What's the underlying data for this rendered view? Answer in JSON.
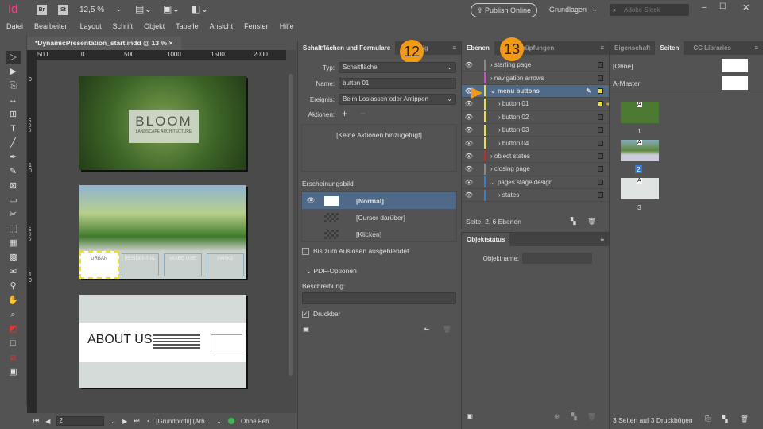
{
  "app": {
    "logo": "Id",
    "bridge": "Br",
    "stock": "St",
    "zoom": "12,5 %",
    "publish": "Publish Online",
    "workspace": "Grundlagen",
    "search_placeholder": "Adobe Stock"
  },
  "menu": [
    "Datei",
    "Bearbeiten",
    "Layout",
    "Schrift",
    "Objekt",
    "Tabelle",
    "Ansicht",
    "Fenster",
    "Hilfe"
  ],
  "document": {
    "tab": "*DynamicPresentation_start.indd @ 13 %",
    "ruler": [
      "500",
      "0",
      "500",
      "1000",
      "1500",
      "2000"
    ],
    "vruler": [
      "0",
      "5 0 0",
      "1 0",
      "5 0 0",
      "1 0"
    ],
    "page1": {
      "title": "BLOOM",
      "subtitle": "LANDSCAPE ARCHITECTURE"
    },
    "page2": {
      "buttons": [
        "URBAN",
        "RESIDENTIAL",
        "MIXED USE",
        "PARKS"
      ]
    },
    "page3": {
      "title": "ABOUT US"
    }
  },
  "status": {
    "page": "2",
    "profile": "[Grundprofil] (Arb...",
    "preflight": "Ohne Feh",
    "ok_color": "#3fb950"
  },
  "buttons_panel": {
    "title": "Schaltflächen und Formulare",
    "tab2": "zeig",
    "badge": "12",
    "type_label": "Typ:",
    "type_value": "Schaltfläche",
    "name_label": "Name:",
    "name_value": "button 01",
    "event_label": "Ereignis:",
    "event_value": "Beim Loslassen oder Antippen",
    "actions_label": "Aktionen:",
    "no_actions": "[Keine Aktionen hinzugefügt]",
    "appearance_label": "Erscheinungsbild",
    "states": [
      "[Normal]",
      "[Cursor darüber]",
      "[Klicken]"
    ],
    "hidden_label": "Bis zum Auslösen ausgeblendet",
    "pdf_options": "PDF-Optionen",
    "description_label": "Beschreibung:",
    "printable_label": "Druckbar"
  },
  "layers_panel": {
    "title": "Ebenen",
    "tab2": "nüpfungen",
    "badge": "13",
    "layers": [
      {
        "name": "starting page",
        "color": "#888888",
        "visible": true,
        "indent": 0,
        "expanded": false
      },
      {
        "name": "navigation arrows",
        "color": "#e040e0",
        "visible": false,
        "indent": 0,
        "expanded": false
      },
      {
        "name": "menu buttons",
        "color": "#f0e020",
        "visible": true,
        "indent": 0,
        "expanded": true,
        "selected": true
      },
      {
        "name": "button 01",
        "color": "#f0e020",
        "visible": true,
        "indent": 1,
        "expanded": false
      },
      {
        "name": "button 02",
        "color": "#f0e020",
        "visible": true,
        "indent": 1,
        "expanded": false
      },
      {
        "name": "button 03",
        "color": "#f0e020",
        "visible": true,
        "indent": 1,
        "expanded": false
      },
      {
        "name": "button 04",
        "color": "#f0e020",
        "visible": true,
        "indent": 1,
        "expanded": false
      },
      {
        "name": "object states",
        "color": "#e02020",
        "visible": true,
        "indent": 0,
        "expanded": false
      },
      {
        "name": "closing page",
        "color": "#888888",
        "visible": true,
        "indent": 0,
        "expanded": false
      },
      {
        "name": "pages stage design",
        "color": "#3080e0",
        "visible": true,
        "indent": 0,
        "expanded": true
      },
      {
        "name": "states",
        "color": "#3080e0",
        "visible": true,
        "indent": 1,
        "expanded": false
      }
    ],
    "footer": "Seite: 2, 6 Ebenen"
  },
  "objektstatus": {
    "title": "Objektstatus",
    "name_label": "Objektname:"
  },
  "pages_panel": {
    "tabs": [
      "Eigenschaft",
      "Seiten",
      "CC Libraries"
    ],
    "masters": [
      "[Ohne]",
      "A-Master"
    ],
    "pages": [
      "1",
      "2",
      "3"
    ],
    "master_letter": "A",
    "footer": "3 Seiten auf 3 Druckbögen"
  }
}
